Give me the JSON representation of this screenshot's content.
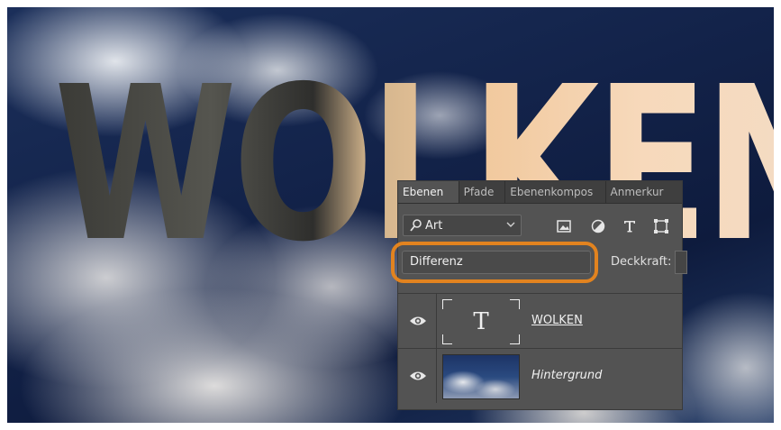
{
  "artwork": {
    "text": "WOLKEN"
  },
  "panel": {
    "tabs": [
      {
        "label": "Ebenen",
        "active": true
      },
      {
        "label": "Pfade",
        "active": false
      },
      {
        "label": "Ebenenkompos",
        "active": false
      },
      {
        "label": "Anmerkur",
        "active": false
      }
    ],
    "filter": {
      "label": "Art",
      "icons": [
        "magnifier-icon",
        "chevron-down-icon",
        "image-filter-icon",
        "adjustment-filter-icon",
        "type-filter-icon",
        "shape-filter-icon"
      ]
    },
    "blend_mode": {
      "value": "Differenz",
      "highlight_color": "#e2831f"
    },
    "opacity": {
      "label": "Deckkraft:"
    },
    "layers": [
      {
        "name": "WOLKEN",
        "type": "text",
        "thumbnail_glyph": "T",
        "visible": true
      },
      {
        "name": "Hintergrund",
        "type": "image",
        "visible": true
      }
    ]
  },
  "colors": {
    "panel_bg": "#535353",
    "tab_bar_bg": "#3f3f3f",
    "accent_orange": "#e2831f"
  }
}
